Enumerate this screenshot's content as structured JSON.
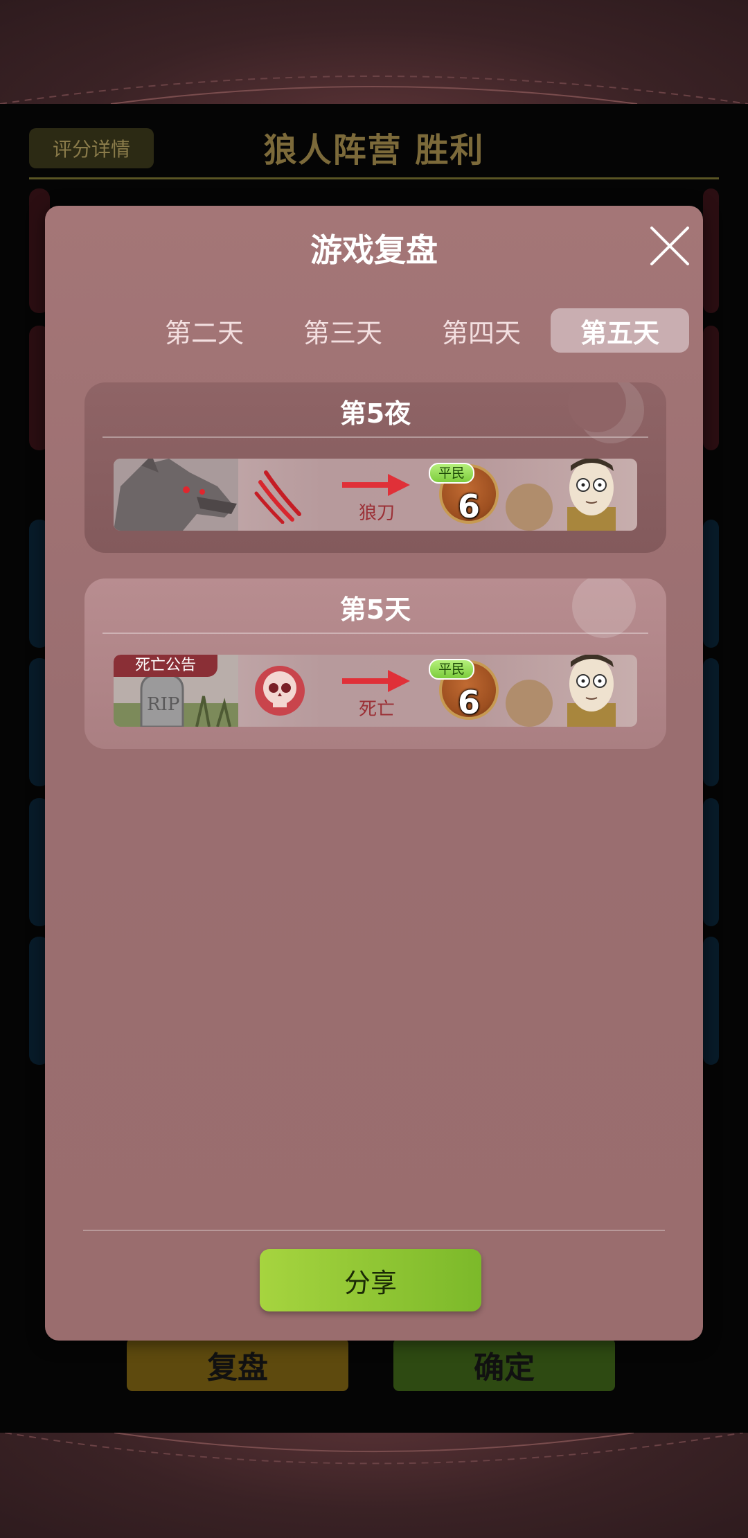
{
  "background": {
    "score_details_label": "评分详情",
    "result_title": "狼人阵营  胜利",
    "replay_label": "复盘",
    "confirm_label": "确定"
  },
  "modal": {
    "title": "游戏复盘",
    "tabs": [
      {
        "label": "第二天",
        "active": false
      },
      {
        "label": "第三天",
        "active": false
      },
      {
        "label": "第四天",
        "active": false
      },
      {
        "label": "第五天",
        "active": true
      }
    ],
    "events": [
      {
        "phase": "第5夜",
        "actor_icon": "werewolf-portrait-icon",
        "action_icon": "claw-mark-icon",
        "action": "狼刀",
        "target_role": "平民",
        "target_seat": "6"
      },
      {
        "phase": "第5天",
        "tag": "死亡公告",
        "actor_icon": "rip-tombstone-icon",
        "action_icon": "skull-icon",
        "action": "死亡",
        "target_role": "平民",
        "target_seat": "6"
      }
    ],
    "share_label": "分享"
  },
  "colors": {
    "modal_bg": "#a47677",
    "active_tab": "#c9aeb1",
    "share_green": "#8cc63f",
    "role_badge_green": "#a6e16a",
    "action_red": "#9b2f35"
  }
}
